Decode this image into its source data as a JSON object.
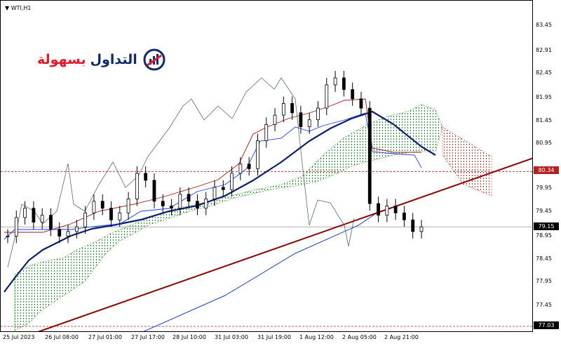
{
  "symbol": {
    "label": "WTI,H1"
  },
  "logo": {
    "text_red": "بسهولة",
    "text_blue": "التداول"
  },
  "price_axis": {
    "ticks": [
      "83.45",
      "82.91",
      "82.45",
      "81.95",
      "81.45",
      "80.95",
      "79.95",
      "79.45",
      "78.95",
      "78.45",
      "77.95",
      "77.45"
    ],
    "tag_dashed": "80.34",
    "tag_current": "79.15",
    "tag_bottom": "77.03"
  },
  "time_axis": {
    "ticks": [
      "25 Jul 2023",
      "26 Jul 08:00",
      "27 Jul 01:00",
      "27 Jul 17:00",
      "28 Jul 10:00",
      "31 Jul 03:00",
      "31 Jul 19:00",
      "1 Aug 12:00",
      "2 Aug 05:00",
      "2 Aug 21:00"
    ]
  },
  "colors": {
    "trendline": "#8b0000",
    "ma_thick": "#0b1f6e",
    "ma_thin": "#1a3fcf",
    "kijun": "#a01818",
    "tenkan": "#1d3cff",
    "chikou": "#5a6a6a",
    "cloud_green": "#1a8a1a",
    "cloud_red": "#c53030",
    "tag_dark": "#000000",
    "tag_red": "#b22222"
  },
  "chart_data": {
    "type": "candlestick",
    "symbol": "WTI",
    "timeframe": "H1",
    "ylim": [
      77.03,
      83.6
    ],
    "x_labels": [
      "25 Jul 2023",
      "26 Jul 08:00",
      "27 Jul 01:00",
      "27 Jul 17:00",
      "28 Jul 10:00",
      "31 Jul 03:00",
      "31 Jul 19:00",
      "1 Aug 12:00",
      "2 Aug 05:00",
      "2 Aug 21:00"
    ],
    "close": [
      78.95,
      79.35,
      79.55,
      79.25,
      79.4,
      79.1,
      78.95,
      79.05,
      79.15,
      79.45,
      79.7,
      79.55,
      79.3,
      79.45,
      79.75,
      80.3,
      80.15,
      79.7,
      79.6,
      79.55,
      79.85,
      79.7,
      79.55,
      79.75,
      80.0,
      79.95,
      80.3,
      80.5,
      80.4,
      81.0,
      81.35,
      81.55,
      81.8,
      81.6,
      81.3,
      81.45,
      81.7,
      82.2,
      82.35,
      82.1,
      81.9,
      81.7,
      79.65,
      79.4,
      79.6,
      79.45,
      79.3,
      79.05,
      79.15
    ],
    "levels": {
      "dashed_level": 80.34,
      "current_price": 79.15,
      "bottom_level": 77.03
    }
  }
}
